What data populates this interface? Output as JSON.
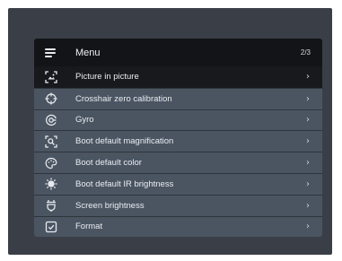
{
  "menu": {
    "title": "Menu",
    "page_indicator": "2/3",
    "chevron": "›",
    "items": [
      {
        "label": "Picture in picture",
        "icon": "picture-in-picture-icon",
        "selected": true
      },
      {
        "label": "Crosshair zero calibration",
        "icon": "crosshair-icon",
        "selected": false
      },
      {
        "label": "Gyro",
        "icon": "gyro-icon",
        "selected": false
      },
      {
        "label": "Boot default magnification",
        "icon": "magnification-icon",
        "selected": false
      },
      {
        "label": "Boot default color",
        "icon": "color-palette-icon",
        "selected": false
      },
      {
        "label": "Boot default IR brightness",
        "icon": "ir-brightness-icon",
        "selected": false
      },
      {
        "label": "Screen brightness",
        "icon": "screen-brightness-icon",
        "selected": false
      },
      {
        "label": "Format",
        "icon": "format-icon",
        "selected": false
      }
    ]
  },
  "colors": {
    "screen_background": "#3a3f47",
    "header_background": "#121417",
    "selected_row": "#17191d",
    "row_background": "#4b5562"
  }
}
